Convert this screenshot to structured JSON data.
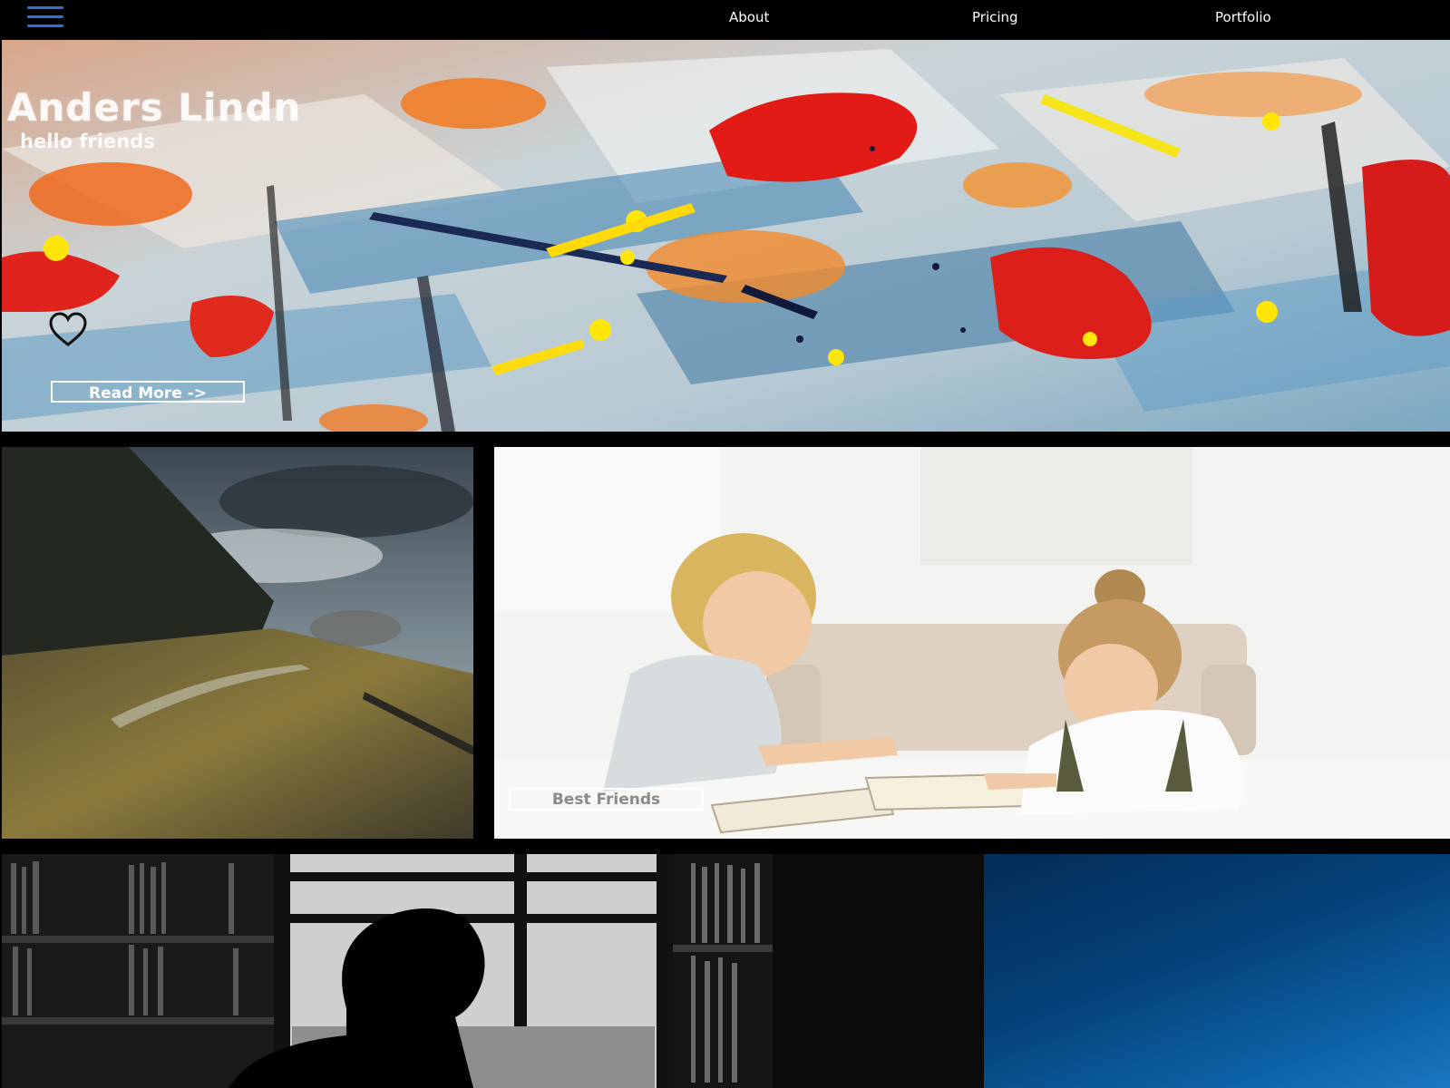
{
  "nav": {
    "menu_icon": "hamburger-menu-icon",
    "links": [
      {
        "label": "About"
      },
      {
        "label": "Pricing"
      },
      {
        "label": "Portfolio"
      }
    ]
  },
  "hero": {
    "title": "Anders Lindn",
    "subtitle": "hello friends",
    "like_icon": "heart-icon",
    "cta_label": "Read More ->"
  },
  "gallery": {
    "forest": {
      "image": "misty forest hillside with trail"
    },
    "kids": {
      "image": "two children reading at a table",
      "caption_label": "Best Friends"
    },
    "library": {
      "image": "silhouette of man between bookshelves"
    },
    "blue": {
      "image": "blue gradient sky"
    }
  },
  "colors": {
    "background": "#000000",
    "menu_icon": "#2d6fd6",
    "nav_text": "#ffffff"
  }
}
